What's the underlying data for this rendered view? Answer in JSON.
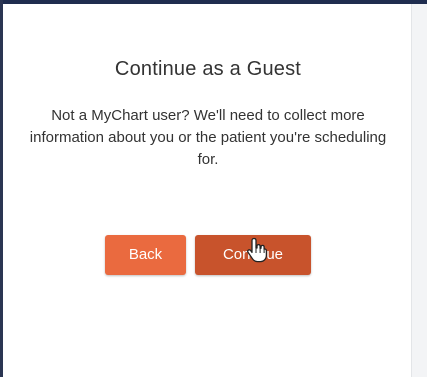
{
  "dialog": {
    "title": "Continue as a Guest",
    "message": "Not a MyChart user? We'll need to collect more information about you or the patient you're scheduling for."
  },
  "buttons": {
    "back_label": "Back",
    "continue_label": "Continue"
  },
  "colors": {
    "back_button": "#ea6a3f",
    "continue_button": "#c8532c",
    "text": "#333333"
  },
  "icons": {
    "cursor": "hand-pointer-icon"
  }
}
